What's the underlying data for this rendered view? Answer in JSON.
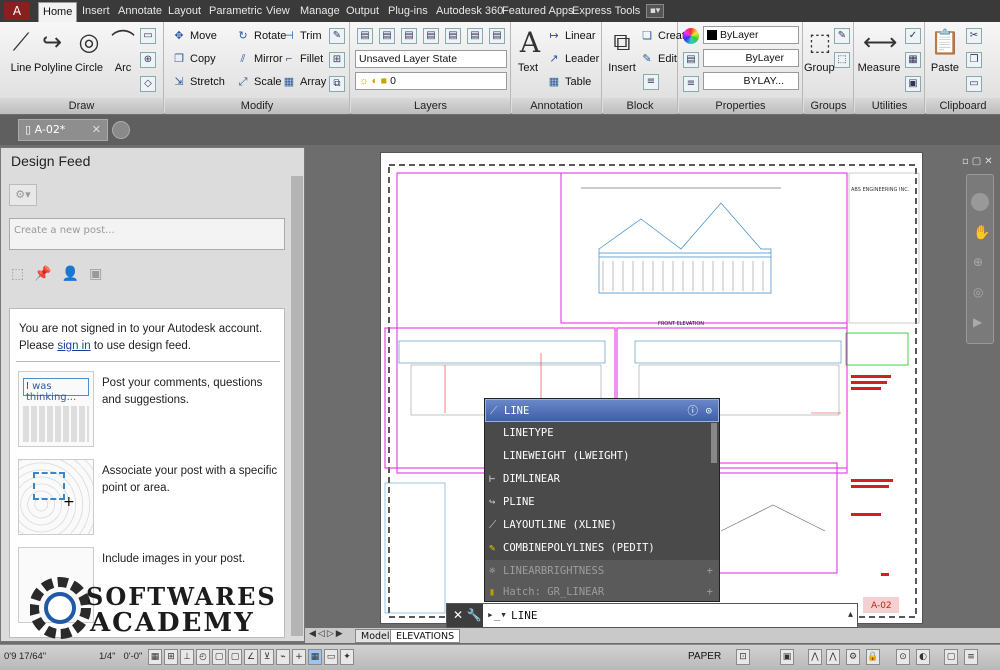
{
  "ribbon_tabs": [
    "Home",
    "Insert",
    "Annotate",
    "Layout",
    "Parametric",
    "View",
    "Manage",
    "Output",
    "Plug-ins",
    "Autodesk 360",
    "Featured Apps",
    "Express Tools"
  ],
  "draw_tools": [
    "Line",
    "Polyline",
    "Circle",
    "Arc"
  ],
  "modify_tools": [
    "Move",
    "Rotate",
    "Trim",
    "Copy",
    "Mirror",
    "Fillet",
    "Stretch",
    "Scale",
    "Array"
  ],
  "annotation": {
    "text": "Text",
    "linear": "Linear",
    "leader": "Leader",
    "table": "Table"
  },
  "block": {
    "insert": "Insert",
    "create": "Create",
    "edit": "Edit"
  },
  "layers": {
    "layer_state": "Unsaved Layer State",
    "current": "0"
  },
  "properties": {
    "color": "ByLayer",
    "linetype": "ByLayer",
    "lineweight": "BYLAY..."
  },
  "groups_btn": "Group",
  "measure_btn": "Measure",
  "paste_btn": "Paste",
  "panel_titles": {
    "draw": "Draw",
    "modify": "Modify",
    "layers": "Layers",
    "annotation": "Annotation",
    "block": "Block",
    "properties": "Properties",
    "groups": "Groups",
    "utilities": "Utilities",
    "clipboard": "Clipboard"
  },
  "doc_tab": "A-02*",
  "feed": {
    "title": "Design Feed",
    "placeholder": "Create a new post...",
    "signin_text": "You are not signed in to your Autodesk account. Please",
    "signin_link": "sign in",
    "signin_suffix": "to use design feed.",
    "tips": [
      "Post your comments, questions and suggestions.",
      "Associate your post with a specific point or area.",
      "Include images in your post."
    ],
    "thinking_label": "I was thinking..."
  },
  "drawing": {
    "company": "ABS ENGINEERING INC.",
    "sheet": "A-02",
    "front_elevation": "FRONT ELEVATION"
  },
  "autocomplete": [
    "LINE",
    "LINETYPE",
    "LINEWEIGHT (LWEIGHT)",
    "DIMLINEAR",
    "PLINE",
    "LAYOUTLINE (XLINE)",
    "COMBINEPOLYLINES (PEDIT)",
    "LINEARBRIGHTNESS",
    "Hatch: GR_LINEAR"
  ],
  "command_text": "LINE",
  "layout_tabs": [
    "Model",
    "ELEVATIONS"
  ],
  "status": {
    "coords": "0'9 17/64\"",
    "scale": "1/4\"",
    "origin": "0'-0\"",
    "paper": "PAPER"
  },
  "watermark": {
    "line1": "SOFTWARES",
    "line2": "ACADEMY"
  }
}
